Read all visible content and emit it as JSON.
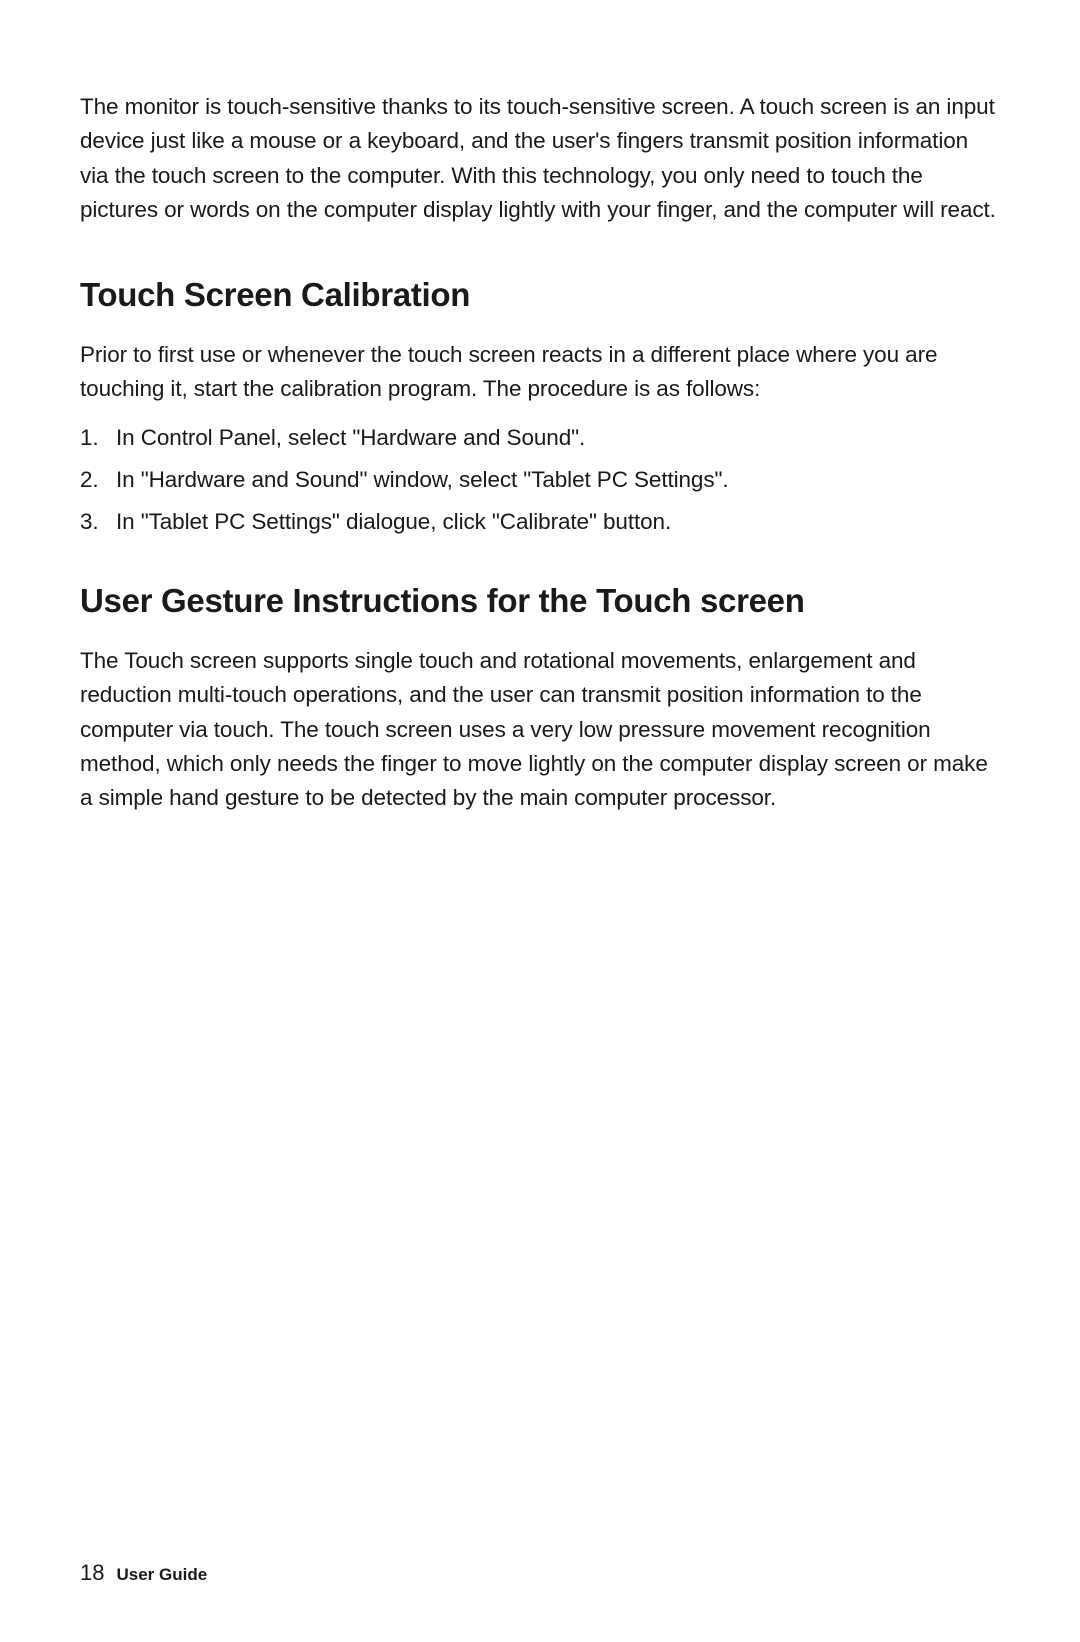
{
  "intro": "The monitor is touch-sensitive thanks to its touch-sensitive screen. A touch screen is an input device just like a mouse or a keyboard, and the user's fingers transmit position information via the touch screen to the computer. With this technology, you only need to touch the pictures or words on the computer display lightly with your finger, and the computer will react.",
  "section1": {
    "heading": "Touch Screen Calibration",
    "paragraph": "Prior to first use or whenever the touch screen reacts in a different place where you are touching it, start the calibration program. The procedure is as follows:",
    "steps": [
      "In Control Panel, select \"Hardware and Sound\".",
      "In \"Hardware and Sound\" window, select \"Tablet PC Settings\".",
      "In \"Tablet PC Settings\" dialogue, click \"Calibrate\" button."
    ]
  },
  "section2": {
    "heading": "User Gesture Instructions for the Touch screen",
    "paragraph": "The Touch screen supports single touch and rotational movements, enlargement and reduction multi-touch operations, and the user can transmit position information to the computer via touch. The touch screen uses a very low pressure movement recognition method, which only needs the finger to move lightly on the computer display screen or make a simple hand gesture to be detected by the main computer processor."
  },
  "footer": {
    "page_number": "18",
    "label": "User Guide"
  }
}
